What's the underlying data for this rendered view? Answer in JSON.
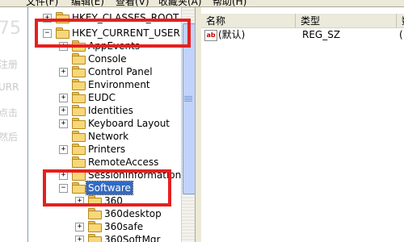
{
  "menubar": {
    "items": [
      "文件(F)",
      "编辑(E)",
      "查看(V)",
      "收藏夹(A)",
      "帮助(H)"
    ]
  },
  "background_page": {
    "fragments": [
      "75",
      "注册",
      "URR",
      "点击",
      "然后"
    ]
  },
  "tree": {
    "nodes": [
      {
        "label": "HKEY_CLASSES_ROOT",
        "expander": "+"
      },
      {
        "label": "HKEY_CURRENT_USER",
        "expander": "−"
      },
      {
        "label": "AppEvents",
        "expander": "+"
      },
      {
        "label": "Console",
        "expander": ""
      },
      {
        "label": "Control Panel",
        "expander": "+"
      },
      {
        "label": "Environment",
        "expander": ""
      },
      {
        "label": "EUDC",
        "expander": "+"
      },
      {
        "label": "Identities",
        "expander": "+"
      },
      {
        "label": "Keyboard Layout",
        "expander": "+"
      },
      {
        "label": "Network",
        "expander": ""
      },
      {
        "label": "Printers",
        "expander": "+"
      },
      {
        "label": "RemoteAccess",
        "expander": ""
      },
      {
        "label": "SessionInformation",
        "expander": "+"
      },
      {
        "label": "Software",
        "expander": "−"
      },
      {
        "label": "360",
        "expander": "+"
      },
      {
        "label": "360desktop",
        "expander": ""
      },
      {
        "label": "360safe",
        "expander": "+"
      },
      {
        "label": "360SoftMgr",
        "expander": "+"
      }
    ]
  },
  "values_pane": {
    "columns": [
      "名称",
      "类型",
      "数"
    ],
    "rows": [
      {
        "icon": "ab",
        "name": "(默认)",
        "type": "REG_SZ",
        "data": "("
      }
    ]
  },
  "annotations": {
    "color": "#e5201f"
  }
}
